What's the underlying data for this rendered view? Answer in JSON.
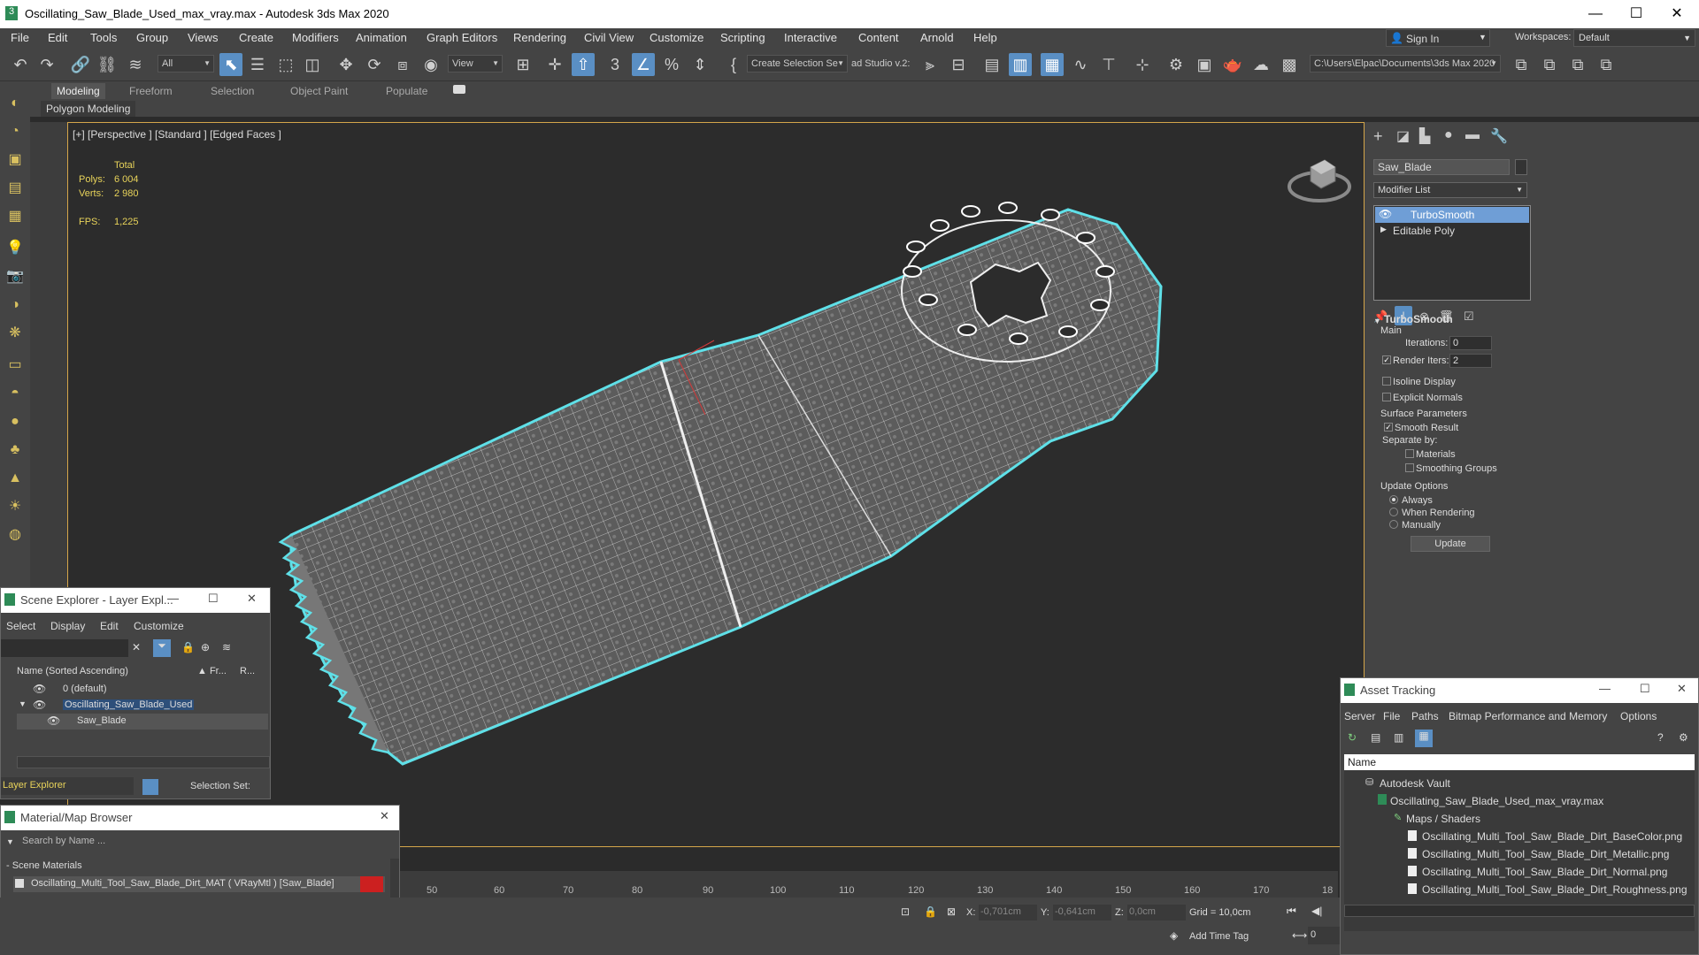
{
  "titlebar": {
    "title": "Oscillating_Saw_Blade_Used_max_vray.max - Autodesk 3ds Max 2020",
    "minimize": "—",
    "maximize": "☐",
    "close": "✕"
  },
  "menu": [
    "File",
    "Edit",
    "Tools",
    "Group",
    "Views",
    "Create",
    "Modifiers",
    "Animation",
    "Graph Editors",
    "Rendering",
    "Civil View",
    "Customize",
    "Scripting",
    "Interactive",
    "Content",
    "Arnold",
    "Help"
  ],
  "signin": "Sign In",
  "workspaces_label": "Workspaces:",
  "workspaces_value": "Default",
  "toolbar": {
    "filter_value": "All",
    "refcoord_value": "View",
    "selection_set_value": "Create Selection Se",
    "vray_label": "ad Studio v.2:",
    "path_value": "C:\\Users\\Elpac\\Documents\\3ds Max 2020"
  },
  "ribbon": {
    "tabs": [
      "Modeling",
      "Freeform",
      "Selection",
      "Object Paint",
      "Populate"
    ],
    "sub_label": "Polygon Modeling"
  },
  "viewport": {
    "label": "[+] [Perspective ] [Standard ] [Edged Faces ]",
    "stats_header": "Total",
    "polys_label": "Polys:",
    "polys_value": "6 004",
    "verts_label": "Verts:",
    "verts_value": "2 980",
    "fps_label": "FPS:",
    "fps_value": "1,225"
  },
  "command_panel": {
    "object_name": "Saw_Blade",
    "modifier_list": "Modifier List",
    "stack": [
      "TurboSmooth",
      "Editable Poly"
    ],
    "rollout_title": "TurboSmooth",
    "main_label": "Main",
    "iterations_label": "Iterations:",
    "iterations_value": "0",
    "render_iters_label": "Render Iters:",
    "render_iters_value": "2",
    "isoline_label": "Isoline Display",
    "explicit_normals_label": "Explicit Normals",
    "surface_params_label": "Surface Parameters",
    "smooth_result_label": "Smooth Result",
    "separate_by_label": "Separate by:",
    "materials_label": "Materials",
    "smoothing_groups_label": "Smoothing Groups",
    "update_options_label": "Update Options",
    "always_label": "Always",
    "when_rendering_label": "When Rendering",
    "manually_label": "Manually",
    "update_button": "Update"
  },
  "scene_explorer": {
    "title": "Scene Explorer - Layer Expl...",
    "menu": [
      "Select",
      "Display",
      "Edit",
      "Customize"
    ],
    "col_name": "Name (Sorted Ascending)",
    "col_fr": "▲ Fr...",
    "col_r": "R...",
    "rows": [
      "0 (default)",
      "Oscillating_Saw_Blade_Used",
      "Saw_Blade"
    ],
    "footer_explorer": "Layer Explorer",
    "footer_selection": "Selection Set:"
  },
  "material_browser": {
    "title": "Material/Map Browser",
    "search_placeholder": "Search by Name ...",
    "section": "- Scene Materials",
    "material": "Oscillating_Multi_Tool_Saw_Blade_Dirt_MAT ( VRayMtl ) [Saw_Blade]"
  },
  "asset_tracking": {
    "title": "Asset Tracking",
    "menu": [
      "Server",
      "File",
      "Paths",
      "Bitmap Performance and Memory",
      "Options"
    ],
    "col_name": "Name",
    "rows": [
      "Autodesk Vault",
      "Oscillating_Saw_Blade_Used_max_vray.max",
      "Maps / Shaders",
      "Oscillating_Multi_Tool_Saw_Blade_Dirt_BaseColor.png",
      "Oscillating_Multi_Tool_Saw_Blade_Dirt_Metallic.png",
      "Oscillating_Multi_Tool_Saw_Blade_Dirt_Normal.png",
      "Oscillating_Multi_Tool_Saw_Blade_Dirt_Roughness.png"
    ]
  },
  "timeline": {
    "ticks": [
      "50",
      "60",
      "70",
      "80",
      "90",
      "100",
      "110",
      "120",
      "130",
      "140",
      "150",
      "160",
      "170",
      "18"
    ]
  },
  "status": {
    "x_label": "X:",
    "x_value": "-0,701cm",
    "y_label": "Y:",
    "y_value": "-0,641cm",
    "z_label": "Z:",
    "z_value": "0,0cm",
    "grid": "Grid = 10,0cm",
    "add_time_tag": "Add Time Tag",
    "frame_value": "0"
  },
  "colors": {
    "accent_blue": "#5a8fc4",
    "viewport_border": "#d4a64a",
    "selection_outline": "#5fe0e8",
    "stat_yellow": "#e8d35a",
    "material_swatch": "#cc2020"
  }
}
